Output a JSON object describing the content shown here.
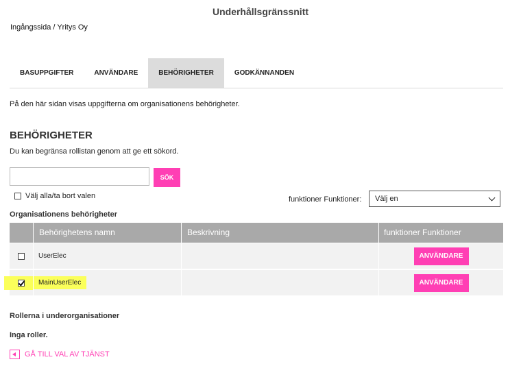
{
  "header": {
    "title": "Underhållsgränssnitt",
    "breadcrumb": {
      "home": "Ingångssida",
      "separator": " / ",
      "current": "Yritys Oy"
    }
  },
  "tabs": [
    {
      "label": "BASUPPGIFTER",
      "active": false
    },
    {
      "label": "ANVÄNDARE",
      "active": false
    },
    {
      "label": "BEHÖRIGHETER",
      "active": true
    },
    {
      "label": "GODKÄNNANDEN",
      "active": false
    }
  ],
  "intro": "På den här sidan visas uppgifterna om organisationens behörigheter.",
  "section": {
    "title": "BEHÖRIGHETER",
    "hint": "Du kan begränsa rollistan genom att ge ett sökord."
  },
  "search": {
    "value": "",
    "placeholder": "",
    "button_label": "SÖK"
  },
  "select_all_label": "Välj alla/ta bort valen",
  "filter": {
    "label": "funktioner Funktioner:",
    "selected": "Välj en"
  },
  "table": {
    "caption": "Organisationens behörigheter",
    "columns": [
      "",
      "Behörighetens namn",
      "Beskrivning",
      "funktioner Funktioner"
    ],
    "rows": [
      {
        "checked": false,
        "name": "UserElec",
        "description": "",
        "action": "ANVÄNDARE",
        "highlighted": false
      },
      {
        "checked": true,
        "name": "MainUserElec",
        "description": "",
        "action": "ANVÄNDARE",
        "highlighted": true
      }
    ]
  },
  "sub_orgs": {
    "title": "Rollerna i underorganisationer",
    "empty": "Inga roller."
  },
  "back_link": "GÅ TILL VAL AV TJÄNST",
  "colors": {
    "accent": "#ff3fb4",
    "header_gray": "#a9a9a9",
    "highlight": "#fbff5a"
  },
  "icons": {
    "back": "back-arrow-icon",
    "dropdown": "chevron-down-icon"
  }
}
